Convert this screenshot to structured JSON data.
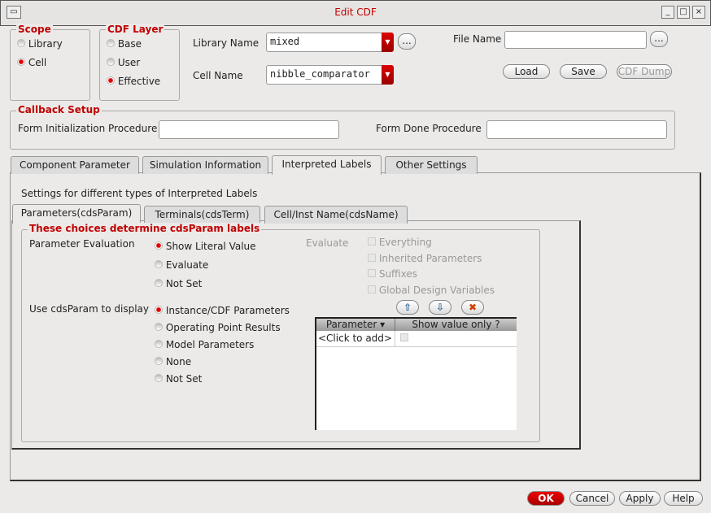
{
  "window": {
    "title": "Edit CDF"
  },
  "scope": {
    "title": "Scope",
    "options": [
      "Library",
      "Cell"
    ],
    "selected": "Cell"
  },
  "cdf_layer": {
    "title": "CDF Layer",
    "options": [
      "Base",
      "User",
      "Effective"
    ],
    "selected": "Effective"
  },
  "library_name": {
    "label": "Library Name",
    "value": "mixed",
    "browse": "..."
  },
  "cell_name": {
    "label": "Cell Name",
    "value": "nibble_comparator"
  },
  "file_name": {
    "label": "File Name",
    "value": "",
    "browse": "..."
  },
  "buttons": {
    "load": "Load",
    "save": "Save",
    "cdf_dump": "CDF Dump"
  },
  "callback": {
    "title": "Callback Setup",
    "init_label": "Form Initialization Procedure",
    "init_value": "",
    "done_label": "Form Done Procedure",
    "done_value": ""
  },
  "tabs": [
    "Component Parameter",
    "Simulation Information",
    "Interpreted Labels",
    "Other Settings"
  ],
  "active_tab": "Interpreted Labels",
  "settings_text": "Settings for different types of Interpreted Labels",
  "subtabs": [
    "Parameters(cdsParam)",
    "Terminals(cdsTerm)",
    "Cell/Inst Name(cdsName)"
  ],
  "choices": {
    "title": "These choices determine cdsParam labels",
    "param_eval_label": "Parameter Evaluation",
    "param_eval_options": [
      "Show Literal Value",
      "Evaluate",
      "Not Set"
    ],
    "param_eval_selected": "Show Literal Value",
    "evaluate_label": "Evaluate",
    "evaluate_checks": [
      "Everything",
      "Inherited Parameters",
      "Suffixes",
      "Global Design Variables"
    ],
    "display_label": "Use cdsParam to display",
    "display_options": [
      "Instance/CDF Parameters",
      "Operating Point Results",
      "Model Parameters",
      "None",
      "Not Set"
    ],
    "display_selected": "Instance/CDF Parameters"
  },
  "table": {
    "columns": [
      "Parameter",
      "Show value only ?"
    ],
    "rows": [
      [
        "<Click to add>",
        ""
      ]
    ]
  },
  "footer": {
    "ok": "OK",
    "cancel": "Cancel",
    "apply": "Apply",
    "help": "Help"
  }
}
